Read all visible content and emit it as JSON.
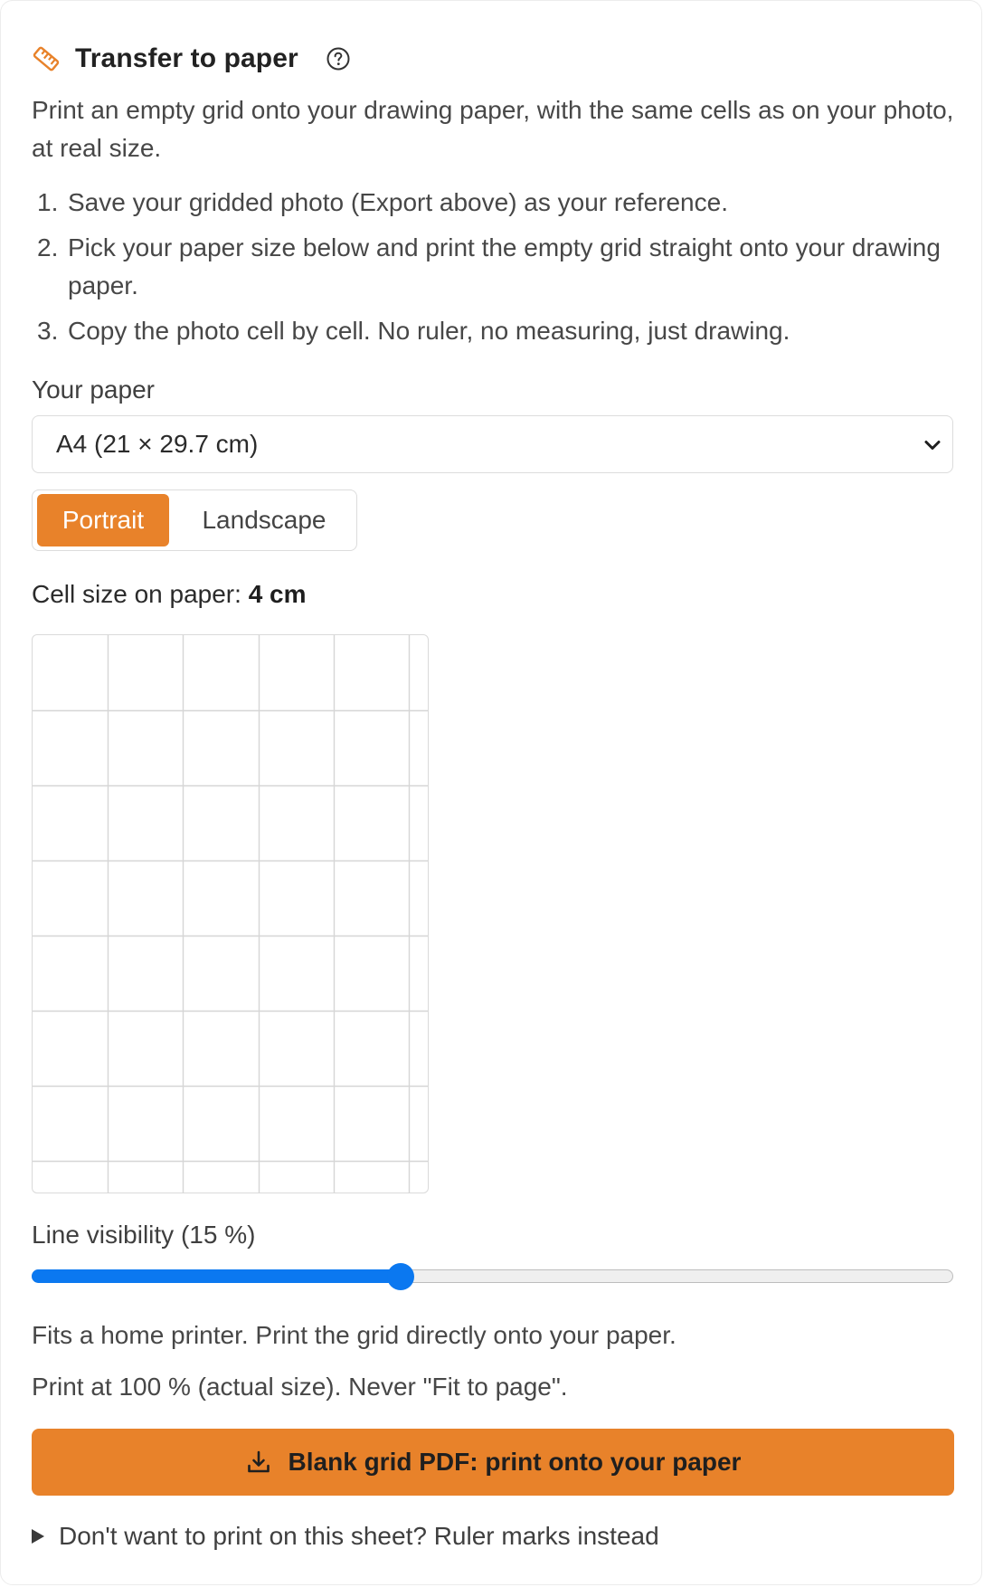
{
  "panel": {
    "title": "Transfer to paper",
    "icons": {
      "title_icon": "ruler-icon",
      "help_icon": "question-circle-icon"
    },
    "intro": "Print an empty grid onto your drawing paper, with the same cells as on your photo, at real size.",
    "steps": [
      {
        "num": "1.",
        "text": "Save your gridded photo (Export above) as your reference."
      },
      {
        "num": "2.",
        "text": "Pick your paper size below and print the empty grid straight onto your drawing paper."
      },
      {
        "num": "3.",
        "text": "Copy the photo cell by cell. No ruler, no measuring, just drawing."
      }
    ]
  },
  "paper": {
    "label": "Your paper",
    "selected": "A4 (21 × 29.7 cm)"
  },
  "orientation": {
    "portrait_label": "Portrait",
    "landscape_label": "Landscape",
    "selected": "Portrait"
  },
  "cell_size": {
    "label": "Cell size on paper: ",
    "value": "4 cm"
  },
  "grid": {
    "paper_width_cm": 21,
    "paper_height_cm": 29.7,
    "cell_cm": 4
  },
  "line_visibility": {
    "label": "Line visibility (15 %)",
    "fraction": 0.4
  },
  "hints": {
    "fits": "Fits a home printer. Print the grid directly onto your paper.",
    "print_scale": "Print at 100 % (actual size). Never \"Fit to page\"."
  },
  "cta": {
    "label": "Blank grid PDF: print onto your paper",
    "icon": "download-icon"
  },
  "disclosure": {
    "label": "Don't want to print on this sheet? Ruler marks instead"
  },
  "colors": {
    "accent": "#e8822a",
    "slider": "#0b78f0",
    "grid_line": "#d6d6d6"
  }
}
